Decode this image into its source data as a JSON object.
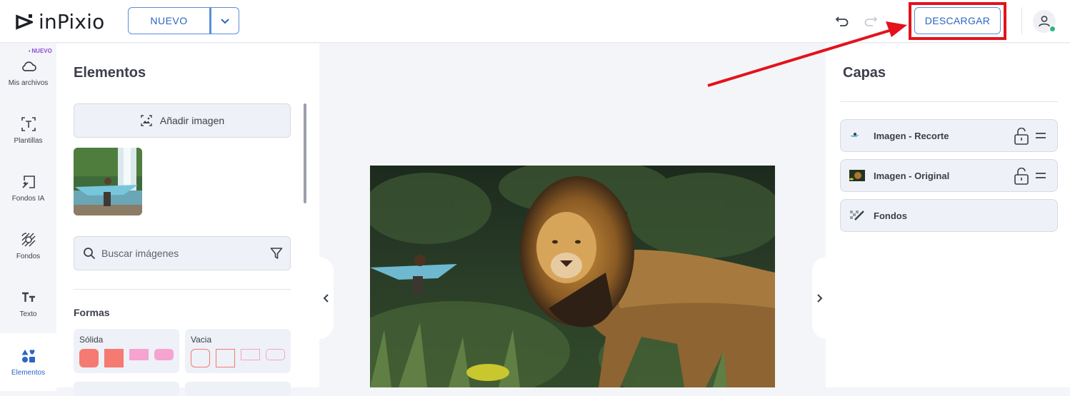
{
  "app": {
    "name": "inPixio"
  },
  "header": {
    "new_button": "NUEVO",
    "download_button": "DESCARGAR",
    "icons": [
      "undo-icon",
      "redo-icon",
      "chevron-down-icon",
      "user-icon"
    ]
  },
  "sidebar": {
    "new_badge": "NUEVO",
    "items": [
      {
        "label": "Mis archivos",
        "icon": "cloud-icon"
      },
      {
        "label": "Plantillas",
        "icon": "template-icon"
      },
      {
        "label": "Fondos IA",
        "icon": "ai-background-icon"
      },
      {
        "label": "Fondos",
        "icon": "background-icon"
      },
      {
        "label": "Texto",
        "icon": "text-icon"
      },
      {
        "label": "Elementos",
        "icon": "shapes-icon",
        "active": true
      }
    ]
  },
  "elements_panel": {
    "title": "Elementos",
    "add_image": "Añadir imagen",
    "search_placeholder": "Buscar imágenes",
    "shapes_title": "Formas",
    "shape_groups": [
      {
        "label": "Sólida"
      },
      {
        "label": "Vacia"
      }
    ]
  },
  "layers_panel": {
    "title": "Capas",
    "layers": [
      {
        "name": "Imagen - Recorte",
        "locked": false
      },
      {
        "name": "Imagen - Original",
        "locked": false
      },
      {
        "name": "Fondos"
      }
    ]
  },
  "colors": {
    "accent": "#2a66c4",
    "highlight": "#e3121b",
    "shape_solid_red": "#f47a72",
    "shape_solid_pink": "#f6a3cf"
  }
}
